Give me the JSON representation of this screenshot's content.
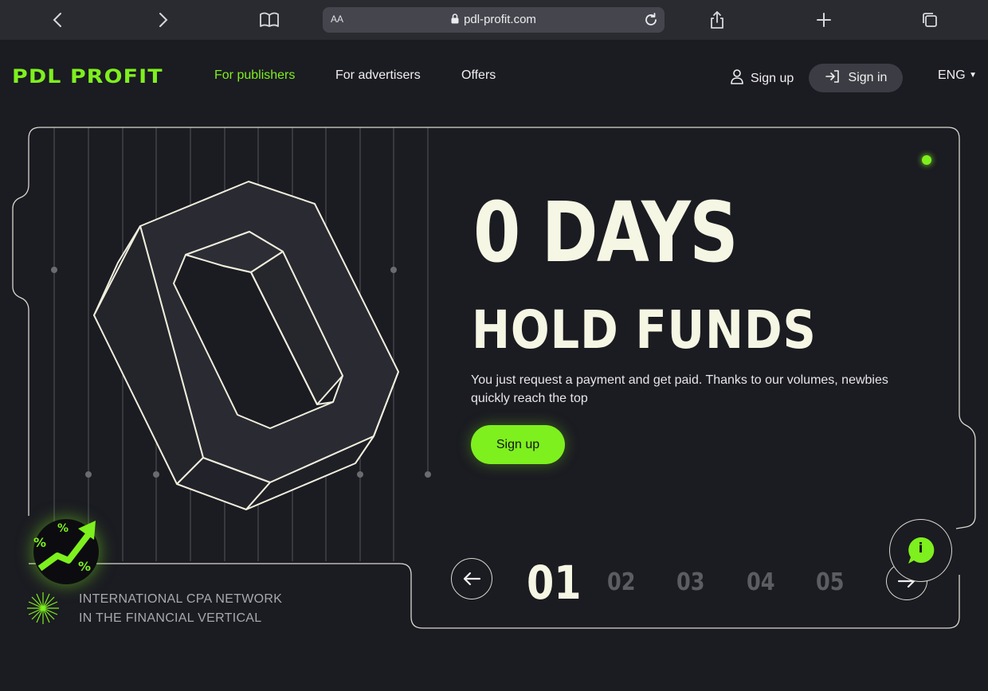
{
  "browser": {
    "text_size_label": "AA",
    "url": "pdl-profit.com"
  },
  "header": {
    "logo": "PDL PROFIT",
    "nav": [
      "For publishers",
      "For advertisers",
      "Offers"
    ],
    "signup": "Sign up",
    "signin": "Sign in",
    "language": "ENG"
  },
  "hero": {
    "headline": "0 DAYS",
    "subheadline": "HOLD FUNDS",
    "description": "You just request a payment and get paid. Thanks to our volumes, newbies quickly reach the top",
    "cta": "Sign up",
    "slides": [
      "01",
      "02",
      "03",
      "04",
      "05"
    ],
    "current_slide": "01",
    "tagline_line1": "INTERNATIONAL CPA NETWORK",
    "tagline_line2": "IN THE FINANCIAL VERTICAL",
    "badge_symbols": [
      "%",
      "%",
      "%"
    ]
  },
  "chat": {
    "icon_label": "i"
  },
  "colors": {
    "accent": "#7ef01e",
    "background": "#1b1b22",
    "text": "#f6f6e4"
  }
}
